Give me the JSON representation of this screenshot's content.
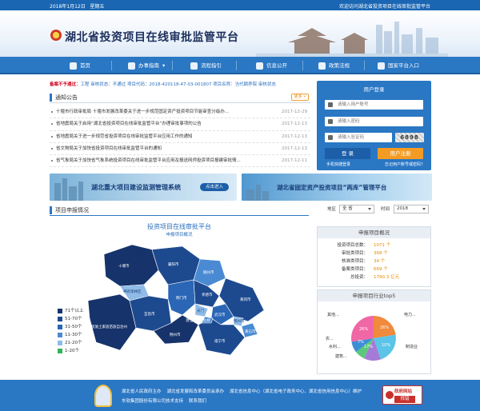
{
  "topbar": {
    "date": "2018年1月12日",
    "weekday": "星期五",
    "welcome": "欢迎访问湖北省投资项目在线审批监管平台"
  },
  "site": {
    "title": "湖北省投资项目在线审批监管平台"
  },
  "nav": [
    {
      "label": "首页",
      "icon": "home-icon"
    },
    {
      "label": "办事指南",
      "icon": "guide-icon",
      "dropdown": true
    },
    {
      "label": "流程指引",
      "icon": "flow-icon"
    },
    {
      "label": "信息公开",
      "icon": "info-icon"
    },
    {
      "label": "政策法规",
      "icon": "policy-icon"
    },
    {
      "label": "国家平台入口",
      "icon": "gateway-icon"
    }
  ],
  "notice": {
    "label": "备案不予通过：",
    "content": "工程  审核状态：不通过  项目代码：2018-420118-47-03-001807  项目名称：当代颐养院  审核状态"
  },
  "announcements": {
    "title": "通知公告",
    "more": "更多 »",
    "items": [
      {
        "text": "十堰市行政审批局 十堰市发展改革委关于进一步规范固定资产投资项目节能审查分级办...",
        "date": "2017-12-29"
      },
      {
        "text": "省地震局关于启用“湖北省投资项目在线审批监管平台”办理审批事项的公告",
        "date": "2017-12-13"
      },
      {
        "text": "省地震局关于进一步规范省投资项目在线审批监管平台应用工作的通知",
        "date": "2017-12-13"
      },
      {
        "text": "省文物局关于加快省投资项目在线审批监管平台的通知",
        "date": "2017-12-13"
      },
      {
        "text": "省气象局关于加快省气象系统投资项目在线审批监管平台应用及报送网师投资项目报建审批情...",
        "date": "2017-12-11"
      }
    ]
  },
  "login": {
    "title": "用户登录",
    "username_placeholder": "请输入用户账号",
    "password_placeholder": "请输入密码",
    "captcha_placeholder": "请输入验证码",
    "captcha": "6898",
    "login_button": "登 录",
    "register_button": "用户注册",
    "mobile_login": "手机快捷登录",
    "forgot": "忘记用户账号或密码？"
  },
  "ads": {
    "left": {
      "title": "湖北重大项目建设监测管理系统",
      "button": "点击进入"
    },
    "right": {
      "title": "湖北省固定资产投资项目“两库”管理平台"
    }
  },
  "project_section": {
    "title": "项目申报情况",
    "region_label": "地区",
    "region_value": "全 省",
    "time_label": "时间",
    "time_value": "2018"
  },
  "map": {
    "title": "投资项目在线审批平台",
    "subtitle": "申报项目概况",
    "labels": [
      "十堰市",
      "神农架林区",
      "襄阳市",
      "随州市",
      "恩施土家族苗族自治州",
      "宜昌市",
      "荆门市",
      "孝感市",
      "荆州市",
      "武汉市",
      "鄂州市",
      "黄石市",
      "黄冈市",
      "咸宁市",
      "潜江",
      "天门",
      "仙桃"
    ],
    "legend": [
      {
        "label": "71个以上",
        "color": "#16336b"
      },
      {
        "label": "51-70个",
        "color": "#1d4a8f"
      },
      {
        "label": "31-50个",
        "color": "#2a66b5"
      },
      {
        "label": "11-30个",
        "color": "#4a8ad2"
      },
      {
        "label": "21-20个",
        "color": "#8fbbe8"
      },
      {
        "label": "1-20个",
        "color": "#33b45a"
      }
    ]
  },
  "overview": {
    "title": "申报项目概况",
    "rows": [
      {
        "key": "投资项目总数：",
        "value": "1071 个"
      },
      {
        "key": "审批类项目：",
        "value": "368 个"
      },
      {
        "key": "核准类项目：",
        "value": "34 个"
      },
      {
        "key": "备案类项目：",
        "value": "669 个"
      },
      {
        "key": "总投资：",
        "value": "1790.3 亿元"
      }
    ]
  },
  "industry": {
    "title": "申报项目行业top5",
    "labels": [
      "其他...",
      "电力...",
      "农...",
      "水利...",
      "建筑...",
      "制造业"
    ],
    "percents": [
      "26%",
      "26%",
      "17%",
      "7%",
      "10%"
    ]
  },
  "footer": {
    "line1": [
      "湖北省人民政府主办",
      "湖北省发展和改革委员会承办",
      "湖北省信息中心（湖北省电子政务中心、湖北省信用信息中心）维护"
    ],
    "line2": [
      "东软集团股份有限公司技术支持",
      "联系我们"
    ],
    "badge_title": "政府网站",
    "badge_sub": "找错"
  }
}
